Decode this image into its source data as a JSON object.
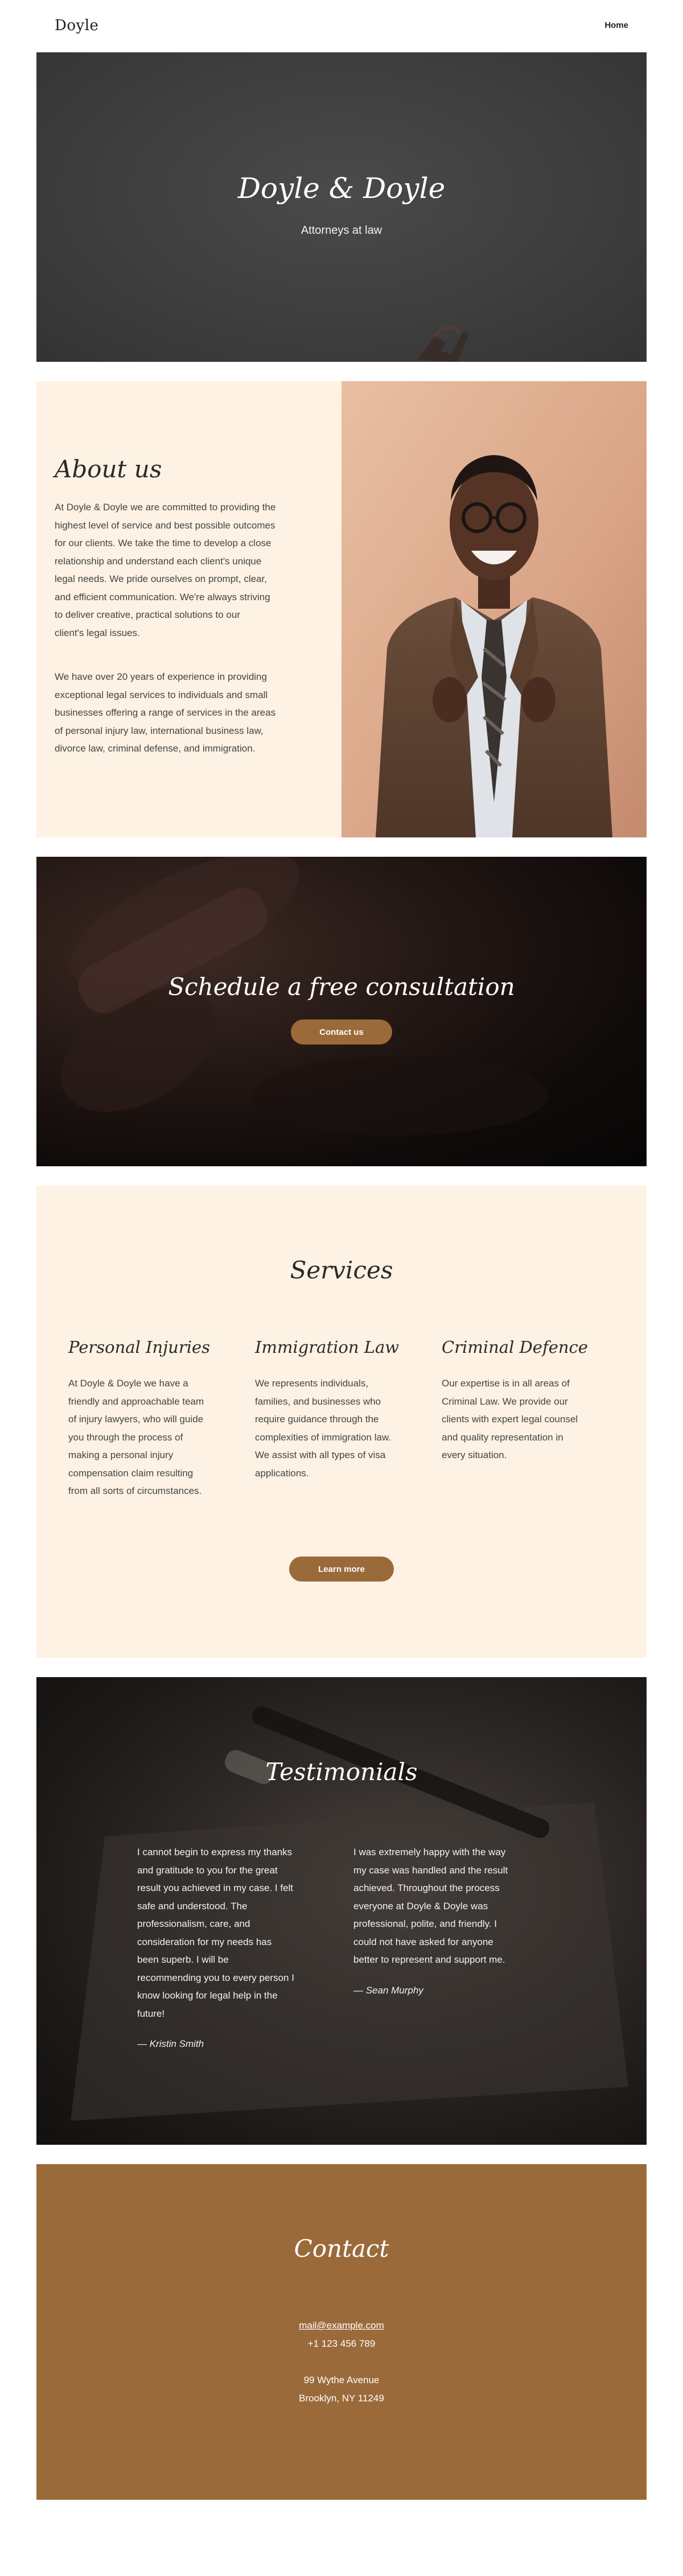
{
  "header": {
    "logo": "Doyle",
    "nav_home": "Home"
  },
  "hero": {
    "title": "Doyle & Doyle",
    "subtitle": "Attorneys at law"
  },
  "about": {
    "title": "About us",
    "paragraphs": [
      [
        "At Doyle & Doyle we are committed to providing the",
        "highest level of service and best possible outcomes",
        "for our clients. We take the time to develop a close",
        "relationship and understand each client's unique",
        "legal needs. We pride ourselves on prompt, clear,",
        "and efficient communication. We're always striving",
        "to deliver creative, practical solutions to our",
        "client's legal issues."
      ],
      [
        "We have over 20 years of experience in providing",
        "exceptional legal services to individuals and small",
        "businesses offering a range of services in the areas",
        "of personal injury law, international business law,",
        "divorce law, criminal defense, and immigration."
      ]
    ]
  },
  "cta": {
    "title": "Schedule a free consultation",
    "button_label": "Contact us"
  },
  "services": {
    "title": "Services",
    "items": [
      {
        "heading": "Personal Injuries",
        "lines": [
          "At Doyle & Doyle we have a",
          "friendly and approachable team",
          "of injury lawyers, who will guide",
          "you through the process of",
          "making a personal injury",
          "compensation claim resulting",
          "from all sorts of circumstances."
        ]
      },
      {
        "heading": "Immigration Law",
        "lines": [
          "We represents individuals,",
          "families, and businesses who",
          "require guidance through the",
          "complexities of immigration law.",
          "We assist with all types of visa",
          "applications."
        ]
      },
      {
        "heading": "Criminal Defence",
        "lines": [
          "Our expertise is in all areas of",
          "Criminal Law. We provide our",
          "clients with expert legal counsel",
          "and quality representation in",
          "every situation."
        ]
      }
    ],
    "button_label": "Learn more"
  },
  "testimonials": {
    "title": "Testimonials",
    "items": [
      {
        "lines": [
          "I cannot begin to express my thanks",
          "and gratitude to you for the great",
          "result you achieved in my case. I felt",
          "safe and understood. The",
          "professionalism, care, and",
          "consideration for my needs has",
          "been superb. I will be",
          "recommending you to every person I",
          "know looking for legal help in the",
          "future!"
        ],
        "author": "— Kristin Smith"
      },
      {
        "lines": [
          "I was extremely happy with the way",
          "my case was handled and the result",
          "achieved. Throughout the process",
          "everyone at Doyle & Doyle was",
          "professional, polite, and friendly. I",
          "could not have asked for anyone",
          "better to represent and support me."
        ],
        "author": "— Sean Murphy"
      }
    ]
  },
  "contact": {
    "title": "Contact",
    "email": "mail@example.com",
    "phone": "+1 123 456 789",
    "address_line1": "99 Wythe Avenue",
    "address_line2": "Brooklyn, NY 11249"
  },
  "colors": {
    "accent": "#9b6a3a",
    "cream": "#fdf2e3"
  }
}
